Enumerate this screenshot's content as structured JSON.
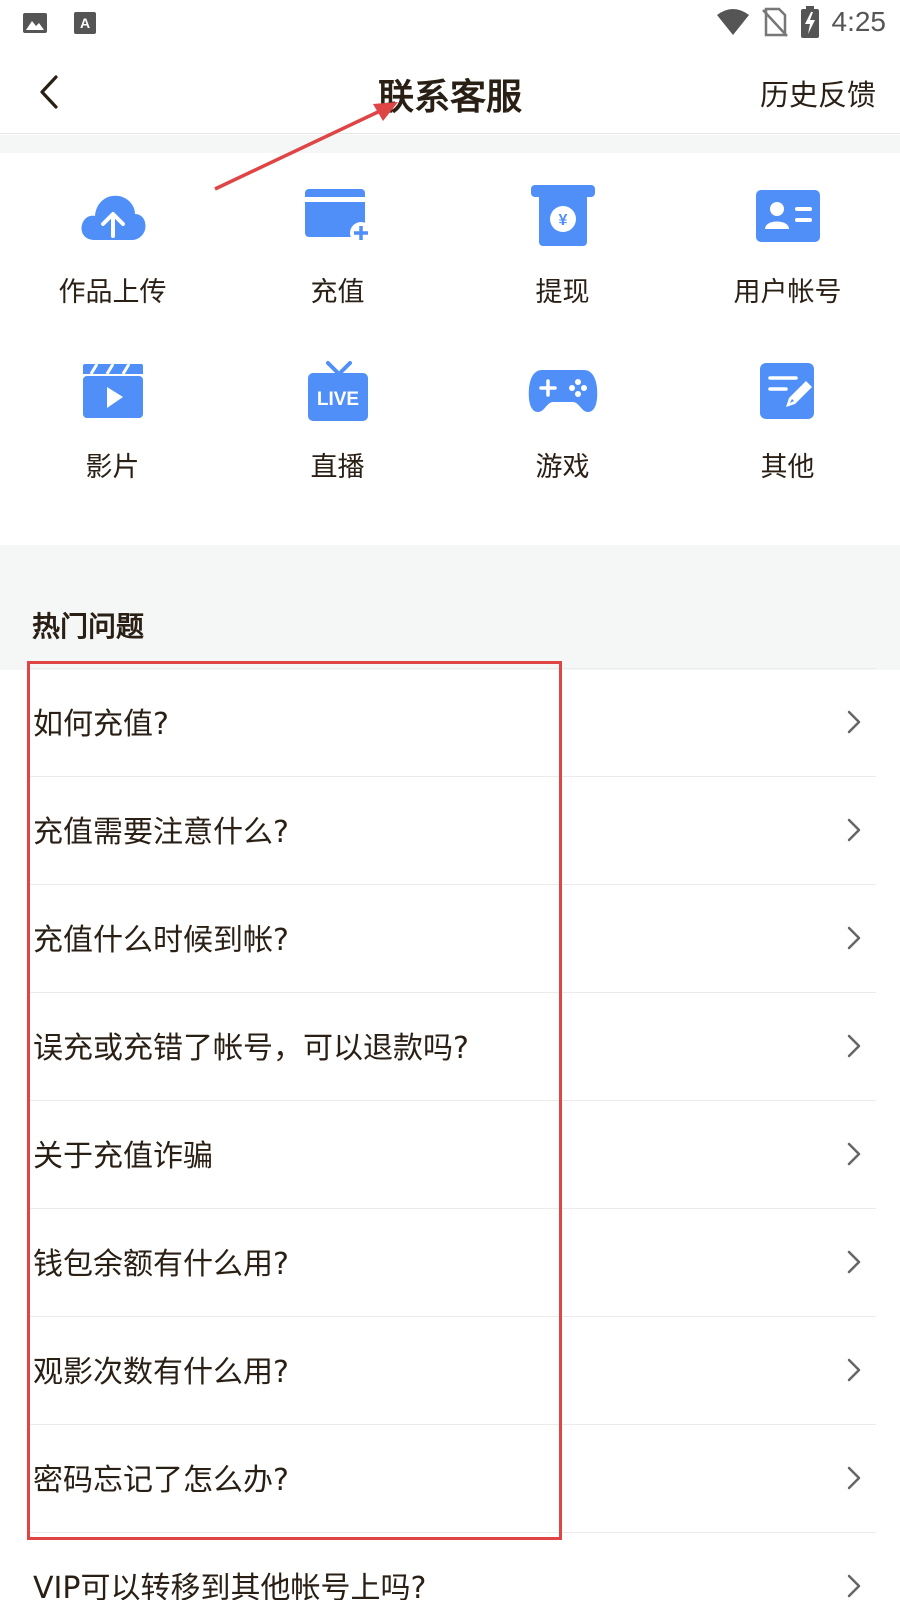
{
  "status_bar": {
    "time": "4:25",
    "icons": [
      "image-icon",
      "text-icon",
      "wifi-icon",
      "no-sim-icon",
      "battery-charging-icon"
    ]
  },
  "header": {
    "title": "联系客服",
    "right_link": "历史反馈",
    "back_icon": "chevron-left-icon"
  },
  "categories": [
    {
      "label": "作品上传",
      "icon": "cloud-upload-icon"
    },
    {
      "label": "充值",
      "icon": "card-add-icon"
    },
    {
      "label": "提现",
      "icon": "withdraw-icon"
    },
    {
      "label": "用户帐号",
      "icon": "id-card-icon"
    },
    {
      "label": "影片",
      "icon": "clapperboard-icon"
    },
    {
      "label": "直播",
      "icon": "live-tv-icon",
      "badge": "LIVE"
    },
    {
      "label": "游戏",
      "icon": "gamepad-icon"
    },
    {
      "label": "其他",
      "icon": "edit-note-icon"
    }
  ],
  "hot_questions": {
    "title": "热门问题",
    "items": [
      "如何充值?",
      "充值需要注意什么?",
      "充值什么时候到帐?",
      "误充或充错了帐号，可以退款吗?",
      "关于充值诈骗",
      "钱包余额有什么用?",
      "观影次数有什么用?",
      "密码忘记了怎么办?",
      "VIP可以转移到其他帐号上吗?"
    ]
  },
  "colors": {
    "accent_blue": "#4f8ff7",
    "annotation_red": "#e04545",
    "text_dark": "#2a1f14",
    "section_bg": "#f5f6f6"
  }
}
